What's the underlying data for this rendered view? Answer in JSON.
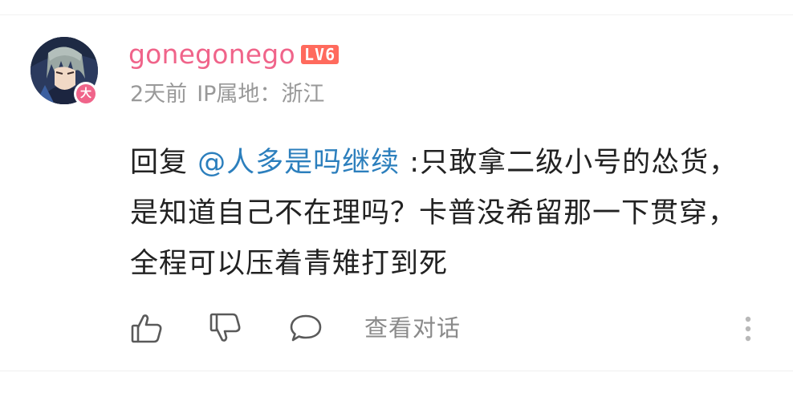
{
  "comment": {
    "user": {
      "name": "gonegonego",
      "level": "LV6",
      "badge": "大",
      "name_color": "#f0648a",
      "level_color": "#ff6a5d"
    },
    "time": "2天前",
    "ip_location": "IP属地：浙江",
    "body": {
      "reply_prefix": "回复 ",
      "mention": "@人多是吗继续",
      "text": " :只敢拿二级小号的怂货，是知道自己不在理吗？卡普没希留那一下贯穿，全程可以压着青雉打到死"
    },
    "actions": {
      "like_icon": "thumbs-up-icon",
      "dislike_icon": "thumbs-down-icon",
      "reply_icon": "chat-bubble-icon",
      "view_conversation": "查看对话",
      "more_icon": "more-vertical-icon"
    }
  },
  "colors": {
    "mention": "#2c7fbd",
    "meta": "#999999",
    "text": "#222222",
    "icon": "#5a5a5a"
  }
}
